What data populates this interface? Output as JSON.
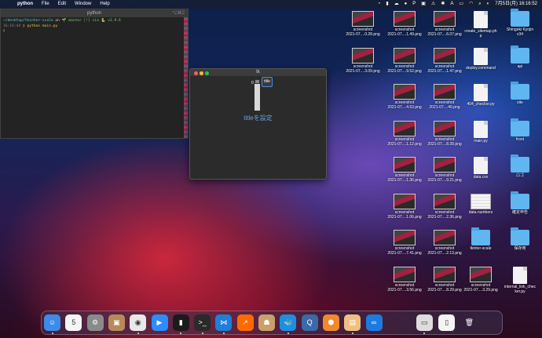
{
  "menubar": {
    "app_name": "python",
    "menus": [
      "File",
      "Edit",
      "Window",
      "Help"
    ],
    "clock": "7月5日(月)  16:16:52"
  },
  "terminal": {
    "title": "python",
    "shortcut": "⌥⌘2",
    "lines": [
      {
        "path": "~/desktop/tkinter-scale",
        "on": " on ",
        "branch": "🌱 master [!] via 🐍 v3.9.6"
      },
      {
        "time": "16:16:44",
        "cmd": " ❯ python main.py"
      },
      {
        "cursor": "▯"
      }
    ]
  },
  "tk_window": {
    "title": "tk",
    "scale_value": "0",
    "button_label": "title",
    "label_text": "titleを設定"
  },
  "desktop_icons": [
    {
      "col": 0,
      "row": 0,
      "type": "shot",
      "label": "screenshot\n2021-07....0.28.png"
    },
    {
      "col": 1,
      "row": 0,
      "type": "shot",
      "label": "screenshot\n2021-07....1.49.png"
    },
    {
      "col": 2,
      "row": 0,
      "type": "shot",
      "label": "screenshot\n2021-07....6.07.png"
    },
    {
      "col": 3,
      "row": 0,
      "type": "doc",
      "label": "create_sitemap.ph\np"
    },
    {
      "col": 4,
      "row": 0,
      "type": "folder",
      "label": "Shingeki Kyojin\nv34"
    },
    {
      "col": 0,
      "row": 1,
      "type": "shot",
      "label": "screenshot\n2021-07....3.09.png"
    },
    {
      "col": 1,
      "row": 1,
      "type": "shot",
      "label": "screenshot\n2021-07....9.52.png"
    },
    {
      "col": 2,
      "row": 1,
      "type": "shot",
      "label": "screenshot\n2021-07....1.47.png"
    },
    {
      "col": 3,
      "row": 1,
      "type": "doc",
      "label": "deploy.command"
    },
    {
      "col": 4,
      "row": 1,
      "type": "folder",
      "label": "api"
    },
    {
      "col": 1,
      "row": 2,
      "type": "shot",
      "label": "screenshot\n2021-07....4.53.png"
    },
    {
      "col": 2,
      "row": 2,
      "type": "shot",
      "label": "screenshot\n2021-07....40.png"
    },
    {
      "col": 3,
      "row": 2,
      "type": "doc",
      "label": "404_checker.py"
    },
    {
      "col": 4,
      "row": 2,
      "type": "folder",
      "label": "site"
    },
    {
      "col": 1,
      "row": 3,
      "type": "shot",
      "label": "screenshot\n2021-07....1.12.png"
    },
    {
      "col": 2,
      "row": 3,
      "type": "shot",
      "label": "screenshot\n2021-07....8.39.png"
    },
    {
      "col": 3,
      "row": 3,
      "type": "doc",
      "label": "main.py"
    },
    {
      "col": 4,
      "row": 3,
      "type": "folder",
      "label": "front"
    },
    {
      "col": 1,
      "row": 4,
      "type": "shot",
      "label": "screenshot\n2021-07....1.36.png"
    },
    {
      "col": 2,
      "row": 4,
      "type": "shot",
      "label": "screenshot\n2021-07....9.21.png"
    },
    {
      "col": 3,
      "row": 4,
      "type": "doc",
      "label": "data.csv"
    },
    {
      "col": 4,
      "row": 4,
      "type": "folder",
      "label": "ロゴ"
    },
    {
      "col": 1,
      "row": 5,
      "type": "shot",
      "label": "screenshot\n2021-07....1.06.png"
    },
    {
      "col": 2,
      "row": 5,
      "type": "shot",
      "label": "screenshot\n2021-07....2.36.png"
    },
    {
      "col": 3,
      "row": 5,
      "type": "sheet",
      "label": "data.numbers"
    },
    {
      "col": 4,
      "row": 5,
      "type": "folder",
      "label": "確定申告"
    },
    {
      "col": 1,
      "row": 6,
      "type": "shot",
      "label": "screenshot\n2021-07....7.41.png"
    },
    {
      "col": 2,
      "row": 6,
      "type": "shot",
      "label": "screenshot\n2021-07....2.13.png"
    },
    {
      "col": 3,
      "row": 6,
      "type": "folder",
      "label": "tkinter-scale"
    },
    {
      "col": 4,
      "row": 6,
      "type": "folder",
      "label": "保存用"
    },
    {
      "col": 1,
      "row": 7,
      "type": "shot",
      "label": "screenshot\n2021-07....3.56.png"
    },
    {
      "col": 2,
      "row": 7,
      "type": "shot",
      "label": "screenshot\n2021-07....8.29.png"
    },
    {
      "col": 3,
      "row": 7,
      "type": "shot",
      "label": "screenshot\n2021-07....3.29.png"
    },
    {
      "col": 4,
      "row": 7,
      "type": "doc",
      "label": "internal_link_chec\nker.py"
    }
  ],
  "dock": [
    {
      "name": "finder",
      "glyph": "☺",
      "color": "#3d8be8",
      "running": true
    },
    {
      "name": "calendar",
      "glyph": "5",
      "color": "#f5f5f5",
      "running": false
    },
    {
      "name": "settings",
      "glyph": "⚙",
      "color": "#8a8a8a",
      "running": false
    },
    {
      "name": "contacts",
      "glyph": "▣",
      "color": "#b88a5a",
      "running": false
    },
    {
      "name": "chrome",
      "glyph": "◉",
      "color": "#e8e8e8",
      "running": true
    },
    {
      "name": "zoom",
      "glyph": "▶",
      "color": "#2d8cff",
      "running": false
    },
    {
      "name": "terminal-green",
      "glyph": "▮",
      "color": "#1b1b1b",
      "running": true
    },
    {
      "name": "terminal",
      "glyph": ">_",
      "color": "#2a2a2a",
      "running": true
    },
    {
      "name": "vscode",
      "glyph": "⋈",
      "color": "#1f7fd6",
      "running": true
    },
    {
      "name": "activity",
      "glyph": "↗",
      "color": "#ff6a00",
      "running": false
    },
    {
      "name": "transmit",
      "glyph": "☗",
      "color": "#c9a06a",
      "running": false
    },
    {
      "name": "docker",
      "glyph": "🐳",
      "color": "#1d8fe0",
      "running": true
    },
    {
      "name": "quicktime",
      "glyph": "Q",
      "color": "#3a6aa8",
      "running": false
    },
    {
      "name": "sourcetree",
      "glyph": "⬢",
      "color": "#f0882c",
      "running": false
    },
    {
      "name": "stickies",
      "glyph": "▤",
      "color": "#f0c080",
      "running": true
    },
    {
      "name": "infinity",
      "glyph": "∞",
      "color": "#1d7be0",
      "running": false
    },
    {
      "name": "preview",
      "glyph": "▭",
      "color": "#ddd",
      "running": true
    },
    {
      "name": "document",
      "glyph": "▯",
      "color": "#f4f4f4",
      "running": false
    },
    {
      "name": "trash",
      "glyph": "🗑",
      "color": "transparent",
      "running": false
    }
  ]
}
